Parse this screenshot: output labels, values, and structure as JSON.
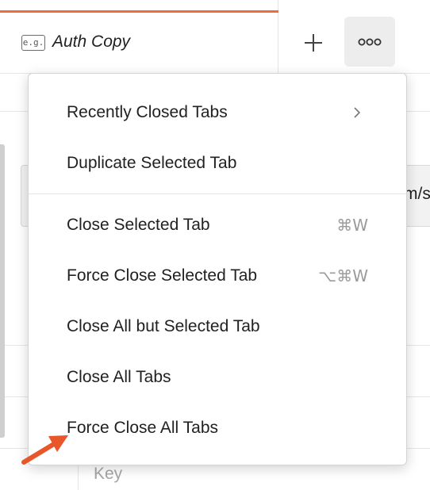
{
  "tab": {
    "badge": "e.g.",
    "title": "Auth Copy"
  },
  "toolbar": {
    "new_tab_icon": "plus-icon",
    "more_icon": "more-horizontal-icon"
  },
  "background": {
    "url_fragment": "m/s",
    "key_placeholder": "Key"
  },
  "menu": {
    "items": [
      {
        "label": "Recently Closed Tabs",
        "submenu": true
      },
      {
        "label": "Duplicate Selected Tab"
      },
      {
        "label": "Close Selected Tab",
        "shortcut": "⌘W"
      },
      {
        "label": "Force Close Selected Tab",
        "shortcut": "⌥⌘W"
      },
      {
        "label": "Close All but Selected Tab"
      },
      {
        "label": "Close All Tabs"
      },
      {
        "label": "Force Close All Tabs"
      }
    ]
  },
  "colors": {
    "accent": "#f26b3a",
    "annotation_arrow": "#e8562a"
  }
}
